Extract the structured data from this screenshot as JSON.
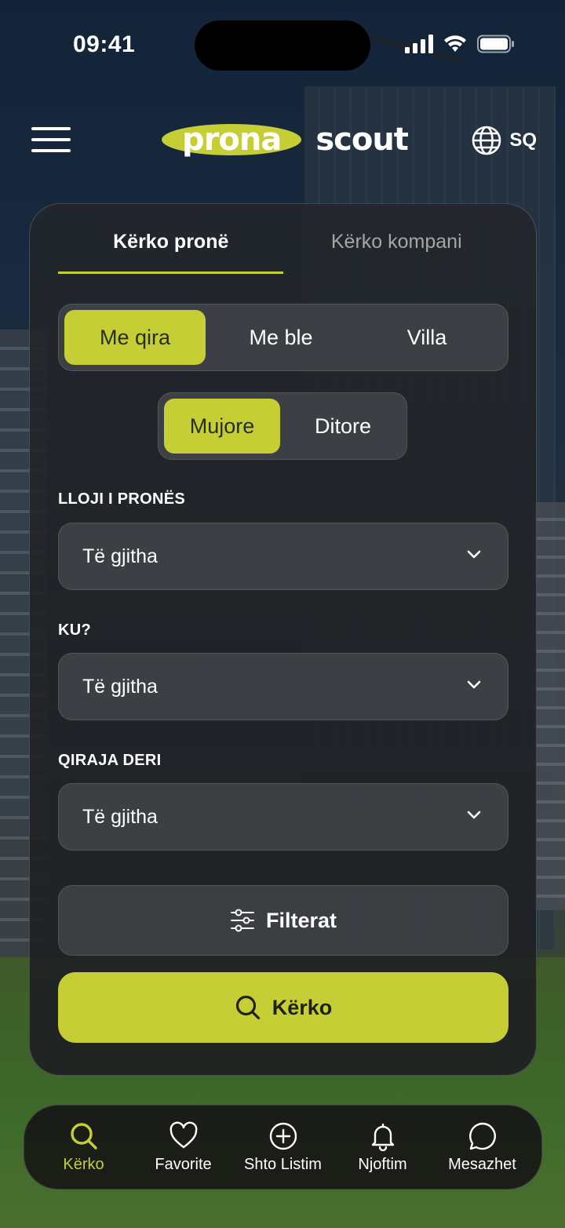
{
  "status_bar": {
    "time": "09:41"
  },
  "header": {
    "logo_part1": "prona",
    "logo_part2": "scout",
    "language": "SQ"
  },
  "search_card": {
    "tabs": [
      {
        "label": "Kërko pronë",
        "active": true
      },
      {
        "label": "Kërko kompani",
        "active": false
      }
    ],
    "listing_type": {
      "options": [
        "Me qira",
        "Me ble",
        "Villa"
      ],
      "selected": "Me qira"
    },
    "period": {
      "options": [
        "Mujore",
        "Ditore"
      ],
      "selected": "Mujore"
    },
    "fields": [
      {
        "label": "LLOJI I PRONËS",
        "value": "Të gjitha"
      },
      {
        "label": "KU?",
        "value": "Të gjitha"
      },
      {
        "label": "QIRAJA DERI",
        "value": "Të gjitha"
      }
    ],
    "filters_label": "Filterat",
    "search_label": "Kërko"
  },
  "bottom_nav": {
    "items": [
      {
        "label": "Kërko",
        "icon": "search-icon",
        "active": true
      },
      {
        "label": "Favorite",
        "icon": "heart-icon",
        "active": false
      },
      {
        "label": "Shto Listim",
        "icon": "plus-circle-icon",
        "active": false
      },
      {
        "label": "Njoftim",
        "icon": "bell-icon",
        "active": false
      },
      {
        "label": "Mesazhet",
        "icon": "chat-icon",
        "active": false
      }
    ]
  },
  "colors": {
    "accent": "#c5cf35",
    "card_bg": "#232629"
  }
}
